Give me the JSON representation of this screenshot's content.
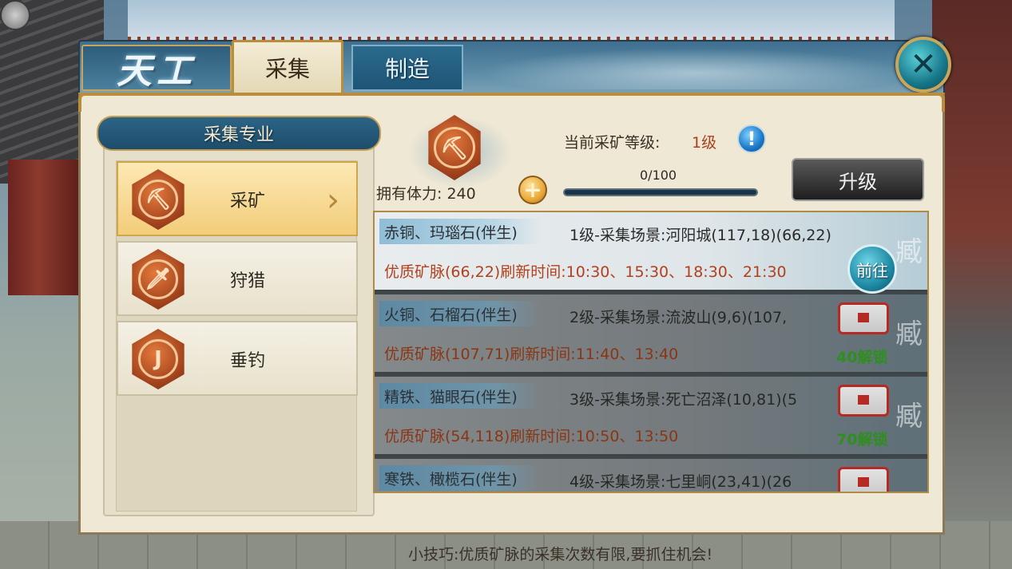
{
  "window": {
    "title": "天工",
    "tabs": [
      {
        "label": "采集",
        "active": true
      },
      {
        "label": "制造",
        "active": false
      }
    ],
    "close_icon": "close-icon"
  },
  "category_panel": {
    "header": "采集专业",
    "items": [
      {
        "label": "采矿",
        "icon": "pickaxe-icon",
        "glyph": "⛏",
        "active": true
      },
      {
        "label": "狩猎",
        "icon": "hunting-knife-icon",
        "glyph": "🗡",
        "active": false
      },
      {
        "label": "垂钓",
        "icon": "fishing-hook-icon",
        "glyph": "J",
        "active": false
      }
    ]
  },
  "skill": {
    "stamina_label": "拥有体力:",
    "stamina_value": "240",
    "level_label": "当前采矿等级:",
    "level_value": "1级",
    "progress_text": "0/100",
    "progress_fraction": 0,
    "upgrade_label": "升级"
  },
  "resources": [
    {
      "name": "赤铜、玛瑙石(伴生)",
      "scene": "1级-采集场景:河阳城(117,18)(66,22)",
      "quality": "优质矿脉(66,22)刷新时间:10:30、15:30、18:30、21:30",
      "locked": false,
      "action_label": "前往"
    },
    {
      "name": "火铜、石榴石(伴生)",
      "scene": "2级-采集场景:流波山(9,6)(107,",
      "quality": "优质矿脉(107,71)刷新时间:11:40、13:40",
      "locked": true,
      "unlock_label": "40解锁"
    },
    {
      "name": "精铁、猫眼石(伴生)",
      "scene": "3级-采集场景:死亡沼泽(10,81)(5",
      "quality": "优质矿脉(54,118)刷新时间:10:50、13:50",
      "locked": true,
      "unlock_label": "70解锁"
    },
    {
      "name": "寒铁、橄榄石(伴生)",
      "scene": "4级-采集场景:七里峒(23,41)(26",
      "quality": "",
      "locked": true,
      "unlock_label": ""
    }
  ],
  "tip": "小技巧:优质矿脉的采集次数有限,要抓住机会!",
  "colors": {
    "accent_gold": "#b98d3c",
    "quality_red": "#b3401c",
    "unlock_green": "#2e8f1e",
    "tab_blue": "#1e5576"
  }
}
